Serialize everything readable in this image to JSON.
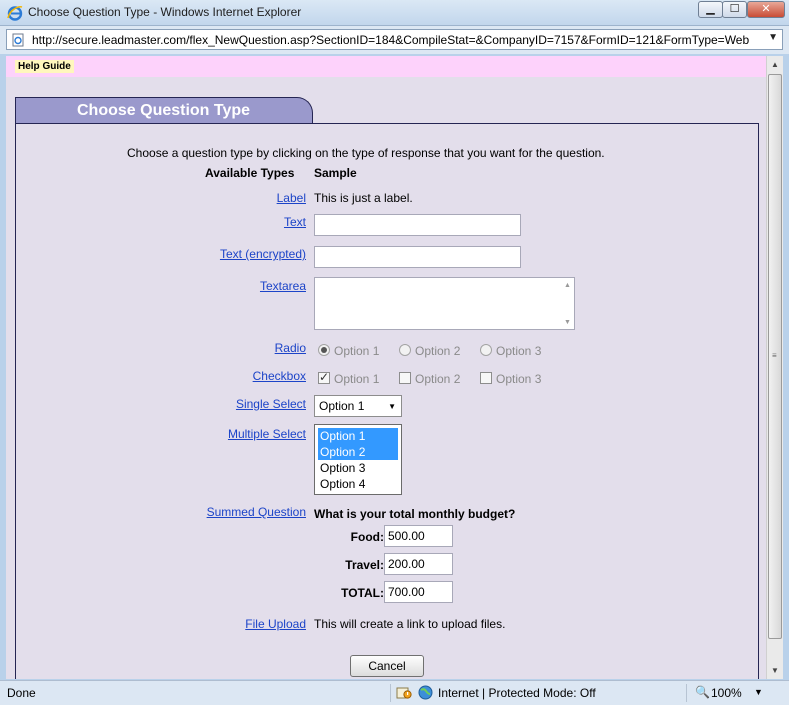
{
  "window": {
    "title": "Choose Question Type - Windows Internet Explorer",
    "min_label": "▁",
    "max_label": "☐",
    "close_label": "✕"
  },
  "address": {
    "url": "http://secure.leadmaster.com/flex_NewQuestion.asp?SectionID=184&CompileStat=&CompanyID=7157&FormID=121&FormType=Web"
  },
  "help": {
    "label": "Help Guide"
  },
  "panel": {
    "title": "Choose Question Type",
    "intro": "Choose a question type by clicking on the type of response that you want for the question.",
    "header_types": "Available Types",
    "header_sample": "Sample"
  },
  "types": {
    "label": {
      "link": "Label",
      "sample": "This is just a label."
    },
    "text": {
      "link": "Text"
    },
    "text_encrypted": {
      "link": "Text (encrypted)"
    },
    "textarea": {
      "link": "Textarea"
    },
    "radio": {
      "link": "Radio",
      "options": [
        "Option 1",
        "Option 2",
        "Option 3"
      ]
    },
    "checkbox": {
      "link": "Checkbox",
      "options": [
        "Option 1",
        "Option 2",
        "Option 3"
      ]
    },
    "single_select": {
      "link": "Single Select",
      "value": "Option 1"
    },
    "multiple_select": {
      "link": "Multiple Select",
      "options": [
        "Option 1",
        "Option 2",
        "Option 3",
        "Option 4"
      ]
    },
    "summed": {
      "link": "Summed Question",
      "question": "What is your total monthly budget?",
      "rows": [
        {
          "label": "Food:",
          "value": "500.00"
        },
        {
          "label": "Travel:",
          "value": "200.00"
        },
        {
          "label": "TOTAL:",
          "value": "700.00"
        }
      ]
    },
    "file_upload": {
      "link": "File Upload",
      "sample": "This will create a link to upload files."
    }
  },
  "cancel_label": "Cancel",
  "status": {
    "text": "Done",
    "zone": "Internet | Protected Mode: Off",
    "zoom": "100%"
  },
  "colors": {
    "tab": "#9a99cc",
    "help_strip": "#fdd2fb",
    "page_bg": "#e3deeb",
    "link": "#1c44c8"
  }
}
